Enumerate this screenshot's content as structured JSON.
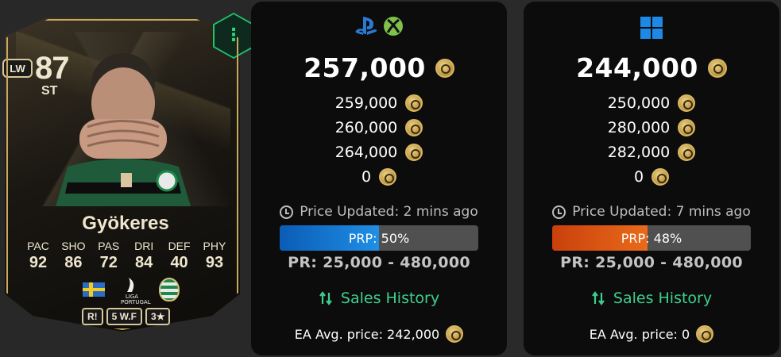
{
  "card": {
    "rating": "87",
    "position": "ST",
    "alt_position": "LW",
    "name": "Gyökeres",
    "menu_icon": "more-vertical-icon",
    "stats": [
      {
        "label": "PAC",
        "value": "92"
      },
      {
        "label": "SHO",
        "value": "86"
      },
      {
        "label": "PAS",
        "value": "72"
      },
      {
        "label": "DRI",
        "value": "84"
      },
      {
        "label": "DEF",
        "value": "40"
      },
      {
        "label": "PHY",
        "value": "93"
      }
    ],
    "league_label": "LIGA PORTUGAL",
    "chips": {
      "role": "R!",
      "weak_foot": "5 W.F",
      "skill_moves": "3★"
    }
  },
  "console_panel": {
    "platforms": [
      "playstation-icon",
      "xbox-icon"
    ],
    "lowest_price": "257,000",
    "prices": [
      "259,000",
      "260,000",
      "264,000",
      "0"
    ],
    "updated": "Price Updated: 2 mins ago",
    "prp_label": "PRP: 50%",
    "prp_percent": 50,
    "prp_color": "#1f8fe6",
    "price_range": "PR: 25,000 - 480,000",
    "sales_history": "Sales History",
    "ea_avg": "EA Avg. price: 242,000"
  },
  "pc_panel": {
    "platforms": [
      "windows-icon"
    ],
    "lowest_price": "244,000",
    "prices": [
      "250,000",
      "280,000",
      "282,000",
      "0"
    ],
    "updated": "Price Updated: 7 mins ago",
    "prp_label": "PRP: 48%",
    "prp_percent": 48,
    "prp_color": "#e96b1a",
    "price_range": "PR: 25,000 - 480,000",
    "sales_history": "Sales History",
    "ea_avg": "EA Avg. price: 0"
  }
}
